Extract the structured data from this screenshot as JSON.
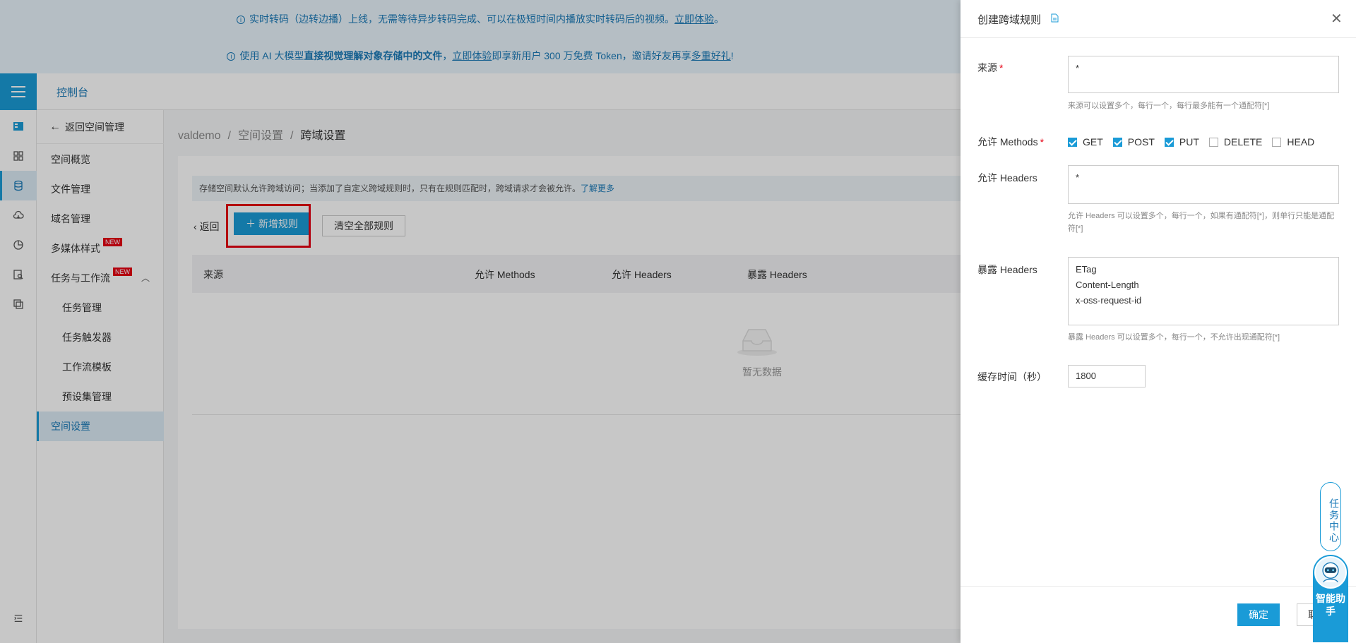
{
  "banners": {
    "line1_text": "实时转码（边转边播）上线，无需等待异步转码完成、可以在极短时间内播放实时转码后的视频。",
    "line1_link": "立即体验",
    "line1_end": "。",
    "line2_pre": "使用 AI 大模型",
    "line2_bold": "直接视觉理解对象存储中的文件",
    "line2_comma": "，",
    "line2_link1": "立即体验",
    "line2_mid": "即享新用户 300 万免费 Token，邀请好友再享",
    "line2_link2": "多重好礼",
    "line2_end": "!"
  },
  "header": {
    "title": "控制台"
  },
  "sidebar": {
    "back_label": "返回空间管理",
    "items": [
      {
        "label": "空间概览"
      },
      {
        "label": "文件管理"
      },
      {
        "label": "域名管理"
      },
      {
        "label": "多媒体样式",
        "badge": "NEW"
      },
      {
        "label": "任务与工作流",
        "badge": "NEW"
      },
      {
        "label": "任务管理"
      },
      {
        "label": "任务触发器"
      },
      {
        "label": "工作流模板"
      },
      {
        "label": "预设集管理"
      },
      {
        "label": "空间设置"
      }
    ]
  },
  "breadcrumb": {
    "a": "valdemo",
    "sep": "/",
    "b": "空间设置",
    "c": "跨域设置"
  },
  "main": {
    "notice_text": "存储空间默认允许跨域访问；当添加了自定义跨域规则时，只有在规则匹配时，跨域请求才会被允许。",
    "notice_link": "了解更多",
    "back_label": "返回",
    "add_label": "新增规则",
    "clear_label": "清空全部规则",
    "columns": [
      "来源",
      "允许 Methods",
      "允许 Headers",
      "暴露 Headers"
    ],
    "empty_text": "暂无数据"
  },
  "drawer": {
    "title": "创建跨域规则",
    "origin_label": "来源",
    "origin_value": "*",
    "origin_help": "来源可以设置多个，每行一个，每行最多能有一个通配符[*]",
    "methods_label": "允许 Methods",
    "methods": [
      {
        "label": "GET",
        "checked": true
      },
      {
        "label": "POST",
        "checked": true
      },
      {
        "label": "PUT",
        "checked": true
      },
      {
        "label": "DELETE",
        "checked": false
      },
      {
        "label": "HEAD",
        "checked": false
      }
    ],
    "allow_headers_label": "允许 Headers",
    "allow_headers_value": "*",
    "allow_headers_help": "允许 Headers 可以设置多个，每行一个，如果有通配符[*]，则单行只能是通配符[*]",
    "expose_headers_label": "暴露 Headers",
    "expose_headers_value": "ETag\nContent-Length\nx-oss-request-id",
    "expose_headers_help": "暴露 Headers 可以设置多个，每行一个，不允许出现通配符[*]",
    "cache_label": "缓存时间（秒）",
    "cache_value": "1800",
    "ok_label": "确定",
    "cancel_label": "取消"
  },
  "floating": {
    "task_center": "任务中心",
    "assistant": "智能助手"
  },
  "colors": {
    "primary": "#1a9bd7",
    "highlight": "#e60012"
  }
}
